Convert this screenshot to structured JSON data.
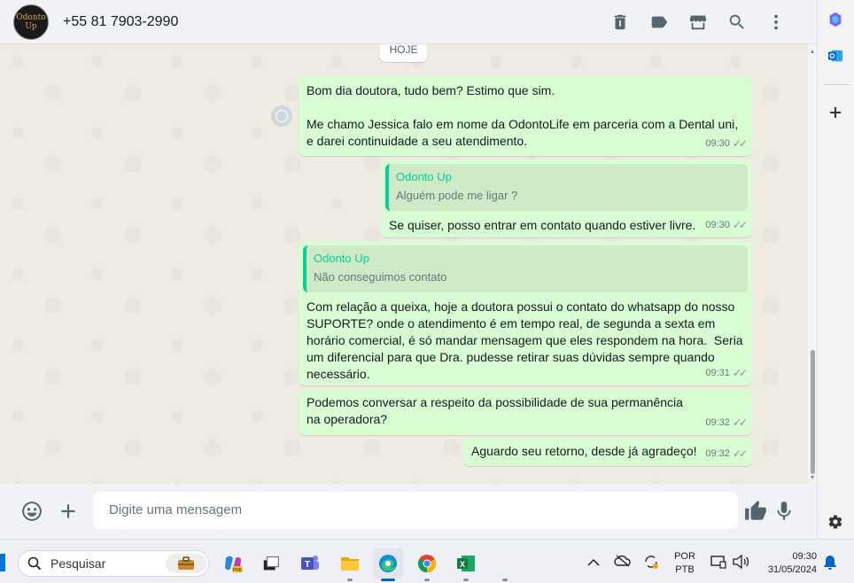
{
  "header": {
    "contact_name": "+55 81 7903-2990",
    "avatar_text": "Odonto Up",
    "icons": [
      "trash-icon",
      "label-icon",
      "store-icon",
      "search-icon",
      "menu-icon"
    ]
  },
  "chat": {
    "date_chip": "HOJE",
    "messages": [
      {
        "text": "Bom dia doutora, tudo bem? Estimo que sim.\n\nMe chamo Jessica falo em nome da OdontoLife em parceria com a Dental uni, e darei continuidade a seu atendimento.",
        "time": "09:30"
      },
      {
        "quote_author": "Odonto Up",
        "quote_text": "Alguém pode me ligar ?",
        "text": "Se quiser, posso entrar em contato quando estiver livre.",
        "time": "09:30"
      },
      {
        "quote_author": "Odonto Up",
        "quote_text": "Não conseguimos contato",
        "text": "Com relação a queixa, hoje a doutora possui o contato do whatsapp do nosso SUPORTE? onde o atendimento é em tempo real, de segunda a sexta em horário comercial, é só mandar mensagem que eles respondem na hora.  Seria um diferencial para que Dra. pudesse retirar suas dúvidas sempre quando necessário.",
        "time": "09:31"
      },
      {
        "text": "Podemos conversar a respeito da possibilidade de sua permanência na operadora?",
        "time": "09:32"
      },
      {
        "text": "Aguardo seu retorno, desde já agradeço!",
        "time": "09:32"
      }
    ]
  },
  "composer": {
    "placeholder": "Digite uma mensagem"
  },
  "taskbar": {
    "search_placeholder": "Pesquisar",
    "lang_line1": "POR",
    "lang_line2": "PTB",
    "time": "09:30",
    "date": "31/05/2024"
  },
  "colors": {
    "bubble_out": "#d9fdd3",
    "quote_accent": "#06cf9c",
    "chat_bg": "#efeae2"
  }
}
